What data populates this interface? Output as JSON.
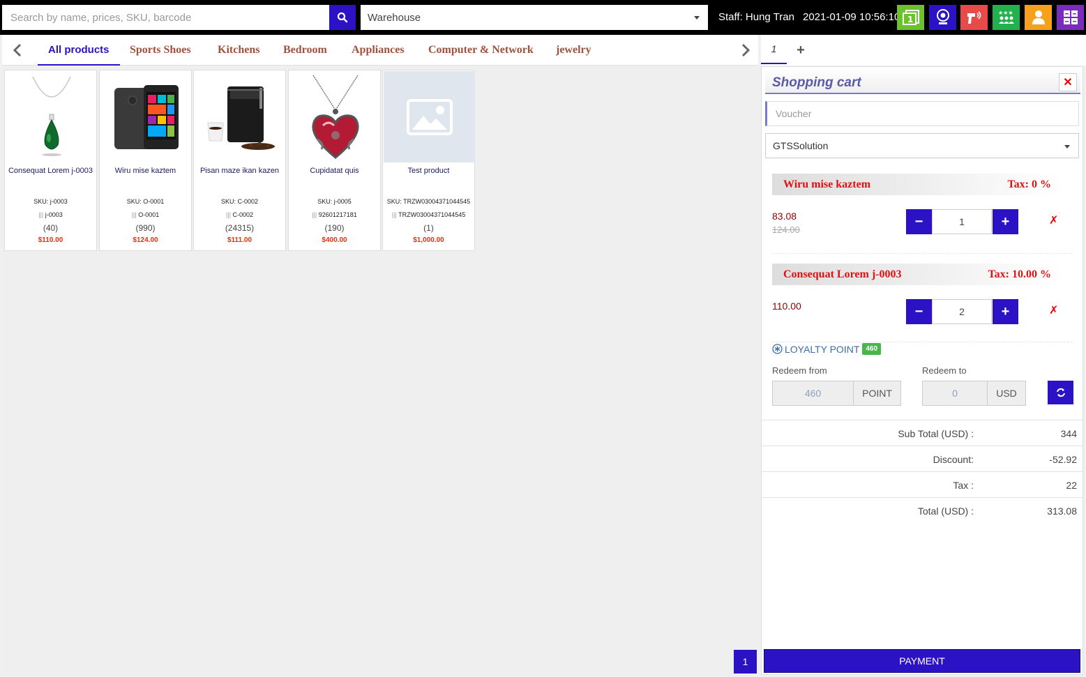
{
  "search": {
    "placeholder": "Search by name, prices, SKU, barcode"
  },
  "warehouse": {
    "value": "Warehouse"
  },
  "header": {
    "staff": "Staff: Hung Tran",
    "datetime": "2021-01-09 10:56:10",
    "toolbar_icons": [
      "window-one-icon",
      "webcam-icon",
      "barcode-scanner-icon",
      "customers-group-icon",
      "user-icon",
      "apps-grid-icon"
    ],
    "toolbar_colors": [
      "#6cc22d",
      "#2b12c4",
      "#e84a4a",
      "#23b14d",
      "#f6a11c",
      "#7b2bbd"
    ]
  },
  "categories": [
    "All products",
    "Sports Shoes",
    "Kitchens",
    "Bedroom",
    "Appliances",
    "Computer & Network",
    "jewelry"
  ],
  "products": [
    {
      "name": "Consequat Lorem j-0003",
      "sku": "SKU: j-0003",
      "barcode": "j-0003",
      "qty": "(40)",
      "price": "$110.00",
      "image": "necklace-icon"
    },
    {
      "name": "Wiru mise kaztem",
      "sku": "SKU: O-0001",
      "barcode": "O-0001",
      "qty": "(990)",
      "price": "$124.00",
      "image": "phone-icon"
    },
    {
      "name": "Pisan maze ikan kazen",
      "sku": "SKU: C-0002",
      "barcode": "C-0002",
      "qty": "(24315)",
      "price": "$111.00",
      "image": "coffee-grinder-icon"
    },
    {
      "name": "Cupidatat quis",
      "sku": "SKU: j-0005",
      "barcode": "92601217181",
      "qty": "(190)",
      "price": "$400.00",
      "image": "heart-pendant-icon"
    },
    {
      "name": "Test product",
      "sku": "SKU: TRZW03004371044545",
      "barcode": "TRZW03004371044545",
      "qty": "(1)",
      "price": "$1,000.00",
      "image": "image-placeholder-icon"
    }
  ],
  "pagination": {
    "page": "1"
  },
  "cart": {
    "tab": "1",
    "title": "Shopping cart",
    "voucher_placeholder": "Voucher",
    "customer": "GTSSolution",
    "items": [
      {
        "name": "Wiru mise kaztem",
        "tax": "Tax: 0 %",
        "price": "83.08",
        "old_price": "124.00",
        "qty": "1"
      },
      {
        "name": "Consequat Lorem j-0003",
        "tax": "Tax: 10.00 %",
        "price": "110.00",
        "old_price": "",
        "qty": "2"
      }
    ],
    "loyalty": {
      "label": "LOYALTY POINT",
      "points": "460",
      "redeem_from_label": "Redeem from",
      "redeem_from_value": "460",
      "redeem_from_unit": "POINT",
      "redeem_to_label": "Redeem to",
      "redeem_to_value": "0",
      "redeem_to_unit": "USD"
    },
    "summary": [
      {
        "label": "Sub Total (USD) :",
        "value": "344"
      },
      {
        "label": "Discount:",
        "value": "-52.92"
      },
      {
        "label": "Tax :",
        "value": "22"
      },
      {
        "label": "Total (USD) :",
        "value": "313.08"
      }
    ],
    "payment_label": "PAYMENT"
  },
  "colors": {
    "accent": "#2b12c4",
    "price": "#e8300b",
    "danger": "#dd1111"
  }
}
